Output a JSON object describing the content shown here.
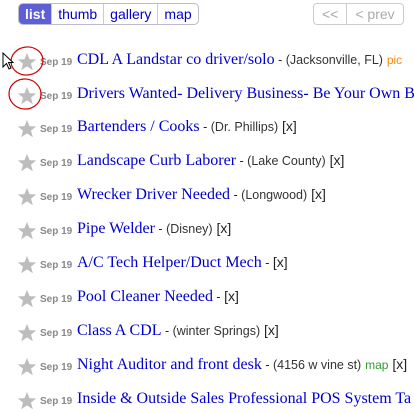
{
  "toolbar": {
    "tabs": [
      {
        "label": "list",
        "active": true
      },
      {
        "label": "thumb",
        "active": false
      },
      {
        "label": "gallery",
        "active": false
      },
      {
        "label": "map",
        "active": false
      }
    ],
    "pager": {
      "first": "<<",
      "prev": "< prev"
    }
  },
  "icons": {
    "star": "star-icon",
    "cursor": "mouse-cursor-icon"
  },
  "colors": {
    "link": "#0000cc",
    "date": "#888888",
    "pic": "#ff8800",
    "map": "#339933",
    "star": "#bdbdbd",
    "annotation": "#cc0000"
  },
  "listings": [
    {
      "date": "Sep 19",
      "title": "CDL A Landstar co driver/solo",
      "dash": " - ",
      "hood": "(Jacksonville, FL)",
      "tag": "pic",
      "tag_type": "pic",
      "x": ""
    },
    {
      "date": "Sep 19",
      "title": "Drivers Wanted- Delivery Business- Be Your Own B",
      "dash": "",
      "hood": "",
      "tag": "",
      "tag_type": "",
      "x": ""
    },
    {
      "date": "Sep 19",
      "title": "Bartenders / Cooks",
      "dash": " - ",
      "hood": "(Dr. Phillips)",
      "tag": "",
      "tag_type": "",
      "x": "[x]"
    },
    {
      "date": "Sep 19",
      "title": "Landscape Curb Laborer",
      "dash": " - ",
      "hood": "(Lake County)",
      "tag": "",
      "tag_type": "",
      "x": "[x]"
    },
    {
      "date": "Sep 19",
      "title": "Wrecker Driver Needed",
      "dash": " - ",
      "hood": "(Longwood)",
      "tag": "",
      "tag_type": "",
      "x": "[x]"
    },
    {
      "date": "Sep 19",
      "title": "Pipe Welder",
      "dash": " - ",
      "hood": "(Disney)",
      "tag": "",
      "tag_type": "",
      "x": "[x]"
    },
    {
      "date": "Sep 19",
      "title": "A/C Tech Helper/Duct Mech",
      "dash": " - ",
      "hood": "",
      "tag": "",
      "tag_type": "",
      "x": "[x]"
    },
    {
      "date": "Sep 19",
      "title": "Pool Cleaner Needed",
      "dash": " - ",
      "hood": "",
      "tag": "",
      "tag_type": "",
      "x": "[x]"
    },
    {
      "date": "Sep 19",
      "title": "Class A CDL",
      "dash": " - ",
      "hood": "(winter Springs)",
      "tag": "",
      "tag_type": "",
      "x": "[x]"
    },
    {
      "date": "Sep 19",
      "title": "Night Auditor and front desk",
      "dash": " - ",
      "hood": "(4156 w vine st)",
      "tag": "map",
      "tag_type": "map",
      "x": "[x]"
    },
    {
      "date": "Sep 19",
      "title": "Inside & Outside Sales Professional POS System Ta",
      "dash": "",
      "hood": "",
      "tag": "",
      "tag_type": "",
      "x": ""
    }
  ]
}
